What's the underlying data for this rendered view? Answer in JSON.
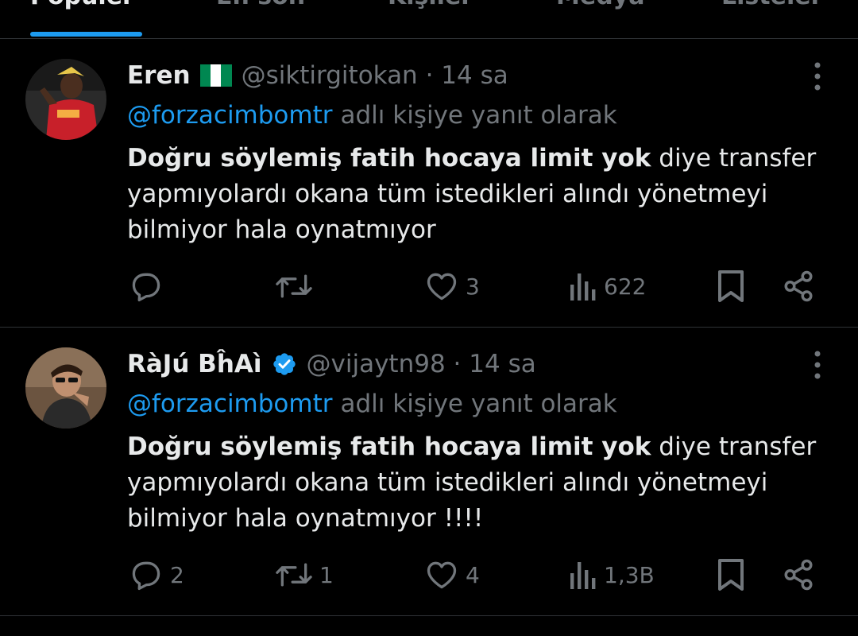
{
  "tabs": [
    {
      "label": "Popüler",
      "active": true
    },
    {
      "label": "En son",
      "active": false
    },
    {
      "label": "Kişiler",
      "active": false
    },
    {
      "label": "Medya",
      "active": false
    },
    {
      "label": "Listeler",
      "active": false
    }
  ],
  "colors": {
    "accent": "#1d9bf0",
    "muted": "#71767b",
    "text": "#e7e9ea",
    "divider": "#2f3336"
  },
  "tweets": [
    {
      "name": "Eren",
      "handle": "@siktirgitokan",
      "time": "14 sa",
      "badge": "nigeria-flag-icon",
      "reply_mention": "@forzacimbomtr",
      "reply_suffix": "adlı kişiye yanıt olarak",
      "text_bold": "Doğru söylemiş fatih hocaya limit yok",
      "text_rest": " diye transfer yapmıyolardı okana tüm istedikleri alındı yönetmeyi bilmiyor hala oynatmıyor",
      "replies": "",
      "retweets": "",
      "likes": "3",
      "views": "622"
    },
    {
      "name": "RàJú BĥAì",
      "handle": "@vijaytn98",
      "time": "14 sa",
      "badge": "verified-badge-icon",
      "reply_mention": "@forzacimbomtr",
      "reply_suffix": "adlı kişiye yanıt olarak",
      "text_bold": "Doğru söylemiş fatih hocaya limit yok",
      "text_rest": " diye transfer yapmıyolardı okana tüm istedikleri alındı yönetmeyi bilmiyor hala oynatmıyor !!!!",
      "replies": "2",
      "retweets": "1",
      "likes": "4",
      "views": "1,3B"
    }
  ]
}
